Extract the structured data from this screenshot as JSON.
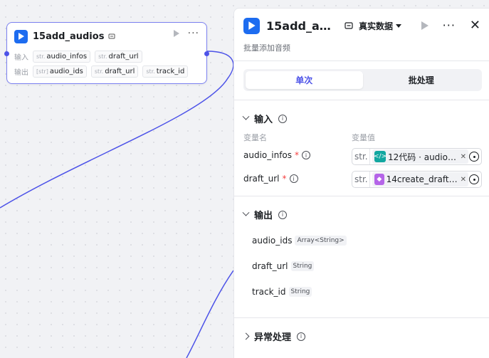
{
  "node": {
    "title": "15add_audios",
    "input_label": "输入",
    "output_label": "输出",
    "inputs": [
      {
        "type": "str.",
        "name": "audio_infos"
      },
      {
        "type": "str.",
        "name": "draft_url"
      }
    ],
    "outputs": [
      {
        "type": "[str]",
        "name": "audio_ids"
      },
      {
        "type": "str.",
        "name": "draft_url"
      },
      {
        "type": "str.",
        "name": "track_id"
      }
    ],
    "more": "···"
  },
  "panel": {
    "title": "15add_au…",
    "mode": "真实数据",
    "more": "···",
    "close": "✕",
    "subtitle": "批量添加音频",
    "tabs": [
      {
        "label": "单次",
        "active": true
      },
      {
        "label": "批处理",
        "active": false
      }
    ],
    "input_section": {
      "title": "输入",
      "col_name": "变量名",
      "col_value": "变量值",
      "params": [
        {
          "name": "audio_infos",
          "required": "*",
          "type": "str.",
          "ref": "12代码 · audioD…",
          "ref_icon_color": "#12a7a0",
          "ref_icon": "</>"
        },
        {
          "name": "draft_url",
          "required": "*",
          "type": "str.",
          "ref": "14create_draft · d…",
          "ref_icon_color": "#b565e8",
          "ref_icon": "◆"
        }
      ]
    },
    "output_section": {
      "title": "输出",
      "items": [
        {
          "name": "audio_ids",
          "type": "Array<String>"
        },
        {
          "name": "draft_url",
          "type": "String"
        },
        {
          "name": "track_id",
          "type": "String"
        }
      ]
    },
    "exception_section": {
      "title": "异常处理"
    }
  },
  "colors": {
    "accent": "#4d53e8",
    "node_border": "#7b80f0",
    "logo_blue": "#1d6cf0",
    "wire": "#4d53e8"
  }
}
